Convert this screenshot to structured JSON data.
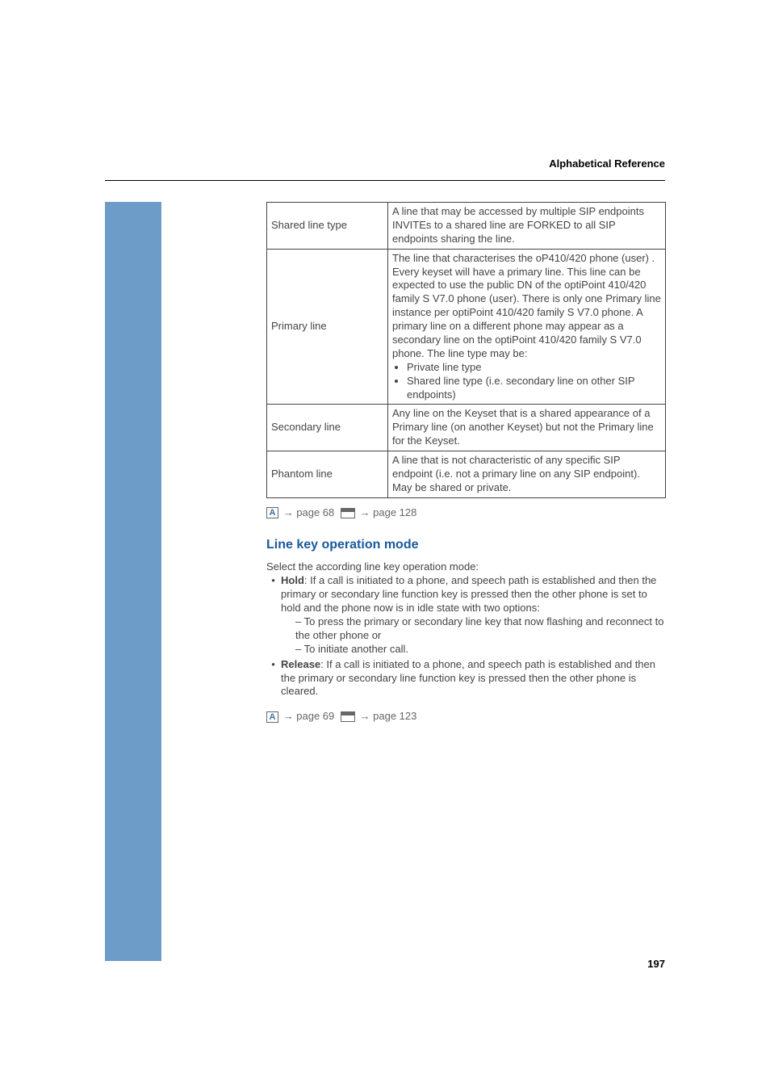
{
  "header": {
    "title": "Alphabetical Reference"
  },
  "table": {
    "rows": [
      {
        "term": "Shared line type",
        "def_html": "A line that may be accessed by multiple SIP endpoints INVITEs to a shared line are FORKED to all SIP endpoints sharing the line."
      },
      {
        "term": "Primary line",
        "def_html": "The line that characterises the oP410/420 phone (user) . Every keyset will have a primary line. This line can be expected to use the public DN of the optiPoint 410/420 family S V7.0 phone (user). There is only one Primary line instance per optiPoint 410/420 family S V7.0 phone. A primary line on a different phone may appear as a secondary line on the optiPoint 410/420 family S V7.0 phone. The line type may be:<ul><li>Private line type</li><li>Shared line type (i.e. secondary line on other SIP endpoints)</li></ul>"
      },
      {
        "term": "Secondary line",
        "def_html": "Any line on the Keyset that is a shared appearance of a Primary line  (on another Keyset) but not the Primary line for the Keyset."
      },
      {
        "term": "Phantom line",
        "def_html": "A line that is not characteristic of any specific SIP endpoint (i.e. not a primary line on any SIP endpoint). May be shared or private."
      }
    ]
  },
  "ref1": {
    "icon_a": "A",
    "arrow": "→",
    "page_a": "page 68",
    "page_b": "page 128"
  },
  "section": {
    "title": "Line key operation mode"
  },
  "body": {
    "intro": "Select the according line key operation mode:",
    "hold_label": "Hold",
    "hold_text": ": If a call is initiated to a phone, and speech path is established and then the primary or secondary line function key is pressed then the other phone is set to hold and the phone now is in idle state with two options:",
    "hold_sub1": "To press the primary or secondary line key that now flashing and reconnect to the other phone or",
    "hold_sub2": "To initiate another call.",
    "release_label": "Release",
    "release_text": ": If a call is initiated to a phone, and speech path is established and then the primary or secondary line function key is pressed then the other phone is cleared."
  },
  "ref2": {
    "icon_a": "A",
    "arrow": "→",
    "page_a": "page 69",
    "page_b": "page 123"
  },
  "page_number": "197"
}
